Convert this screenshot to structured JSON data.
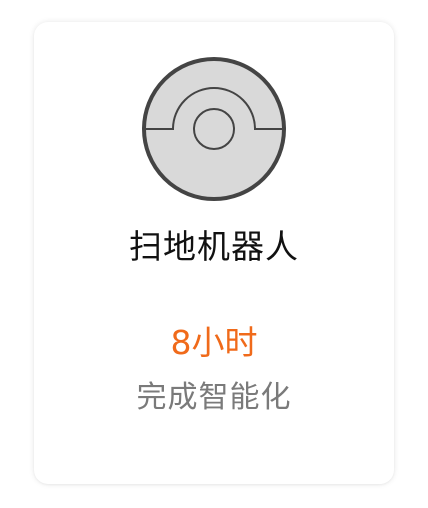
{
  "card": {
    "icon": "robot-vacuum-icon",
    "title": "扫地机器人",
    "value": "8小时",
    "subtitle": "完成智能化"
  },
  "colors": {
    "accent": "#f06a1a",
    "title": "#111111",
    "subtitle": "#7a7a7a",
    "icon_fill": "#d9d9d9",
    "icon_stroke": "#444444"
  }
}
